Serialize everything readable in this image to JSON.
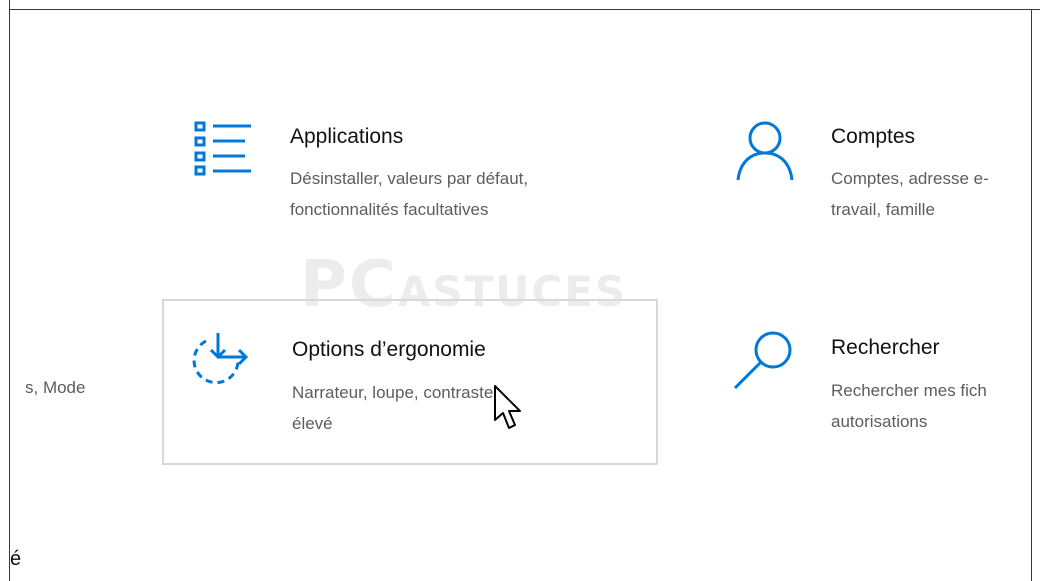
{
  "tiles": {
    "apps": {
      "title": "Applications",
      "desc_line1": "Désinstaller, valeurs par défaut,",
      "desc_line2": "fonctionnalités facultatives",
      "icon": "apps-list-icon"
    },
    "accounts": {
      "title": "Comptes",
      "desc_line1": "Comptes, adresse e-",
      "desc_line2": "travail, famille",
      "icon": "person-icon"
    },
    "ease": {
      "title": "Options d’ergonomie",
      "desc_line1": "Narrateur, loupe, contraste",
      "desc_line2": "élevé",
      "icon": "ease-of-access-icon"
    },
    "search": {
      "title": "Rechercher",
      "desc_line1": "Rechercher mes fich",
      "desc_line2": "autorisations",
      "icon": "search-icon"
    }
  },
  "left_fragment": "s, Mode",
  "bottom_fragment": "é",
  "watermark": {
    "line_big": "PC",
    "line_small": "ASTUCES"
  },
  "accent_color": "#0078d7"
}
